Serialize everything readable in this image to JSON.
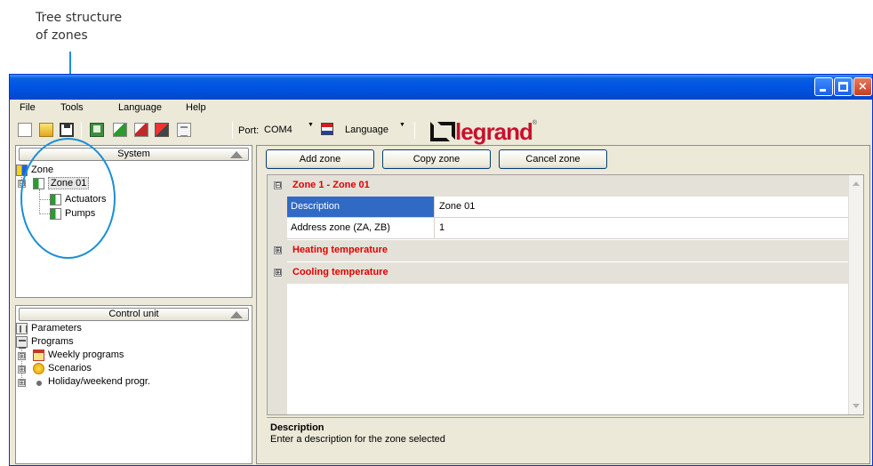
{
  "annotation": {
    "line1": "Tree structure",
    "line2": "of zones"
  },
  "window_controls": {
    "minimize": "minimize",
    "maximize": "maximize",
    "close": "×"
  },
  "menu": [
    "File",
    "Tools",
    "Language",
    "Help"
  ],
  "toolbar": {
    "port_label": "Port:",
    "port_value": "COM4",
    "language_label": "Language",
    "brand": "legrand",
    "brand_reg": "®"
  },
  "system_panel": {
    "title": "System",
    "tree": {
      "root": "Zone",
      "zone": "Zone 01",
      "children": [
        "Actuators",
        "Pumps"
      ]
    }
  },
  "control_unit_panel": {
    "title": "Control unit",
    "items": [
      "Parameters",
      "Programs",
      "Weekly programs",
      "Scenarios",
      "Holiday/weekend progr."
    ]
  },
  "actions": {
    "add": "Add zone",
    "copy": "Copy zone",
    "cancel": "Cancel zone"
  },
  "grid": {
    "category_main": "Zone 1 - Zone 01",
    "expand_symbol": "⊟",
    "collapse_symbol": "⊞",
    "properties": [
      {
        "name": "Description",
        "value": "Zone 01"
      },
      {
        "name": "Address zone (ZA, ZB)",
        "value": "1"
      }
    ],
    "categories": [
      "Heating temperature",
      "Cooling temperature"
    ]
  },
  "description_box": {
    "title": "Description",
    "text": "Enter a description for the zone selected"
  }
}
